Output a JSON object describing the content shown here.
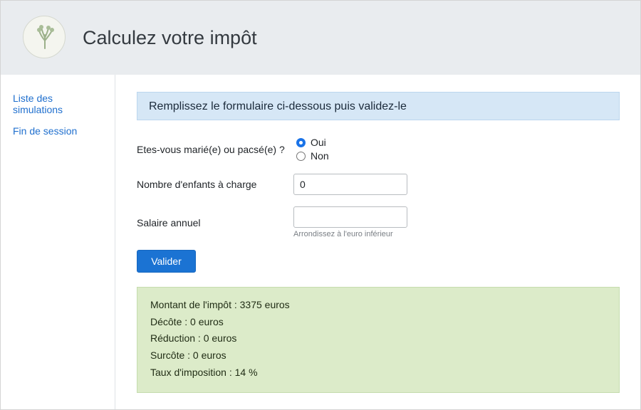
{
  "header": {
    "title": "Calculez votre impôt",
    "logo_icon": "tree-sprout-icon"
  },
  "sidebar": {
    "items": [
      {
        "label": "Liste des simulations"
      },
      {
        "label": "Fin de session"
      }
    ]
  },
  "form": {
    "banner": "Remplissez le formulaire ci-dessous puis validez-le",
    "married": {
      "label": "Etes-vous marié(e) ou pacsé(e) ?",
      "options": [
        {
          "label": "Oui",
          "checked": true
        },
        {
          "label": "Non",
          "checked": false
        }
      ]
    },
    "children": {
      "label": "Nombre d'enfants à charge",
      "value": "0"
    },
    "salary": {
      "label": "Salaire annuel",
      "value": "",
      "help": "Arrondissez à l'euro inférieur"
    },
    "submit_label": "Valider"
  },
  "result": {
    "lines": [
      "Montant de l'impôt : 3375 euros",
      "Décôte : 0 euros",
      "Réduction : 0 euros",
      "Surcôte : 0 euros",
      "Taux d'imposition : 14 %"
    ]
  },
  "colors": {
    "header_bg": "#e9ecef",
    "link": "#1f6fce",
    "primary_button": "#1b73d3",
    "info_banner": "#d6e7f6",
    "success_box": "#dcebc9"
  }
}
